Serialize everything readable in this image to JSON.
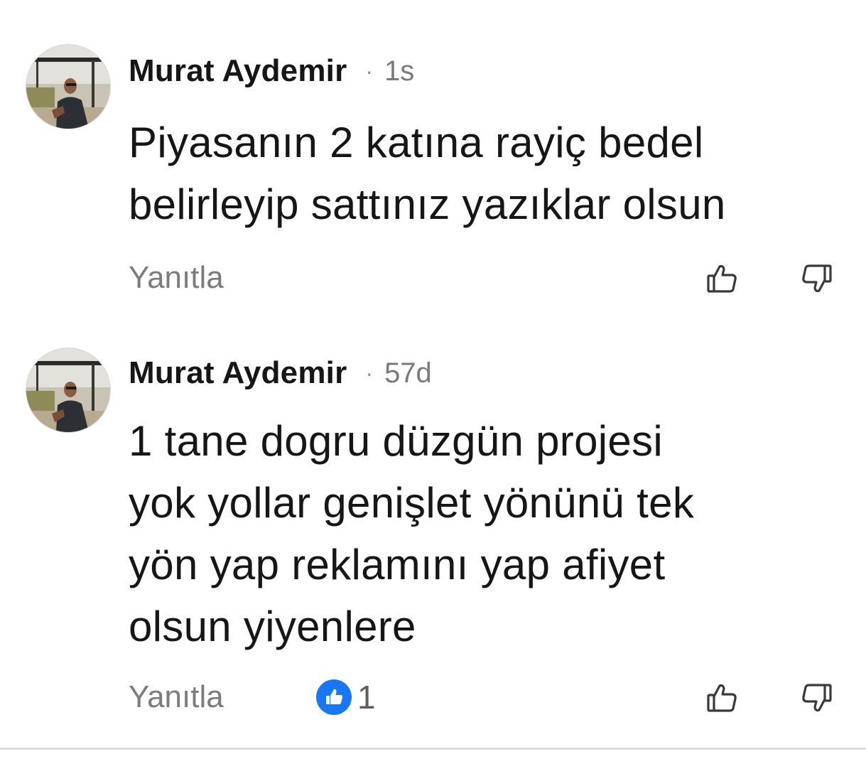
{
  "comments": [
    {
      "author": "Murat Aydemir",
      "separator": "·",
      "time": "1s",
      "text": "Piyasanın 2 katına rayiç bedel\nbelirleyip sattınız yazıklar olsun",
      "reply_label": "Yanıtla",
      "like_icon": "thumb-up-outline-icon",
      "dislike_icon": "thumb-down-outline-icon"
    },
    {
      "author": "Murat Aydemir",
      "separator": "·",
      "time": "57d",
      "text": "1 tane dogru düzgün projesi\nyok yollar genişlet yönünü tek\nyön yap reklamını yap afiyet\nolsun yiyenlere",
      "reply_label": "Yanıtla",
      "reaction_count": "1",
      "reaction_icon": "like-reaction-icon",
      "like_icon": "thumb-up-outline-icon",
      "dislike_icon": "thumb-down-outline-icon"
    }
  ],
  "colors": {
    "reaction_blue": "#1877f2",
    "muted_text": "#7c7c7c",
    "primary_text": "#161616"
  }
}
